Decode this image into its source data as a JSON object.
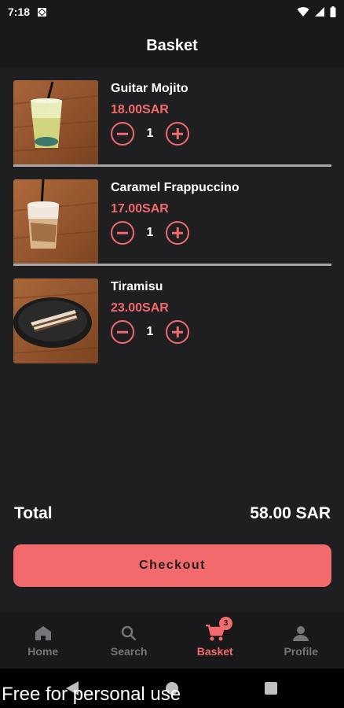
{
  "status": {
    "time": "7:18"
  },
  "header": {
    "title": "Basket"
  },
  "items": [
    {
      "name": "Guitar Mojito",
      "price": "18.00SAR",
      "qty": "1",
      "image": "mojito-drink"
    },
    {
      "name": "Caramel Frappuccino",
      "price": "17.00SAR",
      "qty": "1",
      "image": "frappuccino-drink"
    },
    {
      "name": "Tiramisu",
      "price": "23.00SAR",
      "qty": "1",
      "image": "tiramisu-cake"
    }
  ],
  "total": {
    "label": "Total",
    "value": "58.00 SAR"
  },
  "checkout": {
    "label": "Checkout"
  },
  "nav": {
    "home": "Home",
    "search": "Search",
    "basket": "Basket",
    "basket_badge": "3",
    "profile": "Profile",
    "active": "basket"
  },
  "watermark": "Free for personal use",
  "colors": {
    "accent": "#f26a6c",
    "background": "#1f1f21",
    "bar": "#19191b",
    "inactive": "#75757a"
  }
}
